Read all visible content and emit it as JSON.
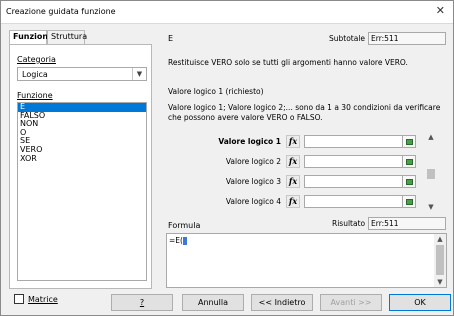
{
  "window": {
    "title": "Creazione guidata funzione",
    "close_glyph": "✕"
  },
  "tabs": [
    {
      "label": "Funzioni",
      "active": true
    },
    {
      "label": "Struttura",
      "active": false
    }
  ],
  "category": {
    "label": "Categoria",
    "value": "Logica"
  },
  "function_list": {
    "label": "Funzione",
    "items": [
      "E",
      "FALSO",
      "NON",
      "O",
      "SE",
      "VERO",
      "XOR"
    ],
    "selected": "E"
  },
  "function_info": {
    "name": "E",
    "subtotal_label": "Subtotale",
    "subtotal_value": "Err:511",
    "description": "Restituisce VERO solo se tutti gli argomenti hanno valore VERO.",
    "arg_title": "Valore logico 1 (richiesto)",
    "arg_description": "Valore logico 1; Valore logico 2;... sono da 1 a 30 condizioni da verificare che possono avere valore VERO o FALSO."
  },
  "arguments": [
    {
      "label": "Valore logico 1",
      "bold": true,
      "value": ""
    },
    {
      "label": "Valore logico 2",
      "bold": false,
      "value": ""
    },
    {
      "label": "Valore logico 3",
      "bold": false,
      "value": ""
    },
    {
      "label": "Valore logico 4",
      "bold": false,
      "value": ""
    }
  ],
  "fx_glyph": "fx",
  "formula": {
    "label": "Formula",
    "value": "=E(",
    "result_label": "Risultato",
    "result_value": "Err:511"
  },
  "bottom": {
    "matrix_label": "Matrice",
    "help_label": "?",
    "cancel_label": "Annulla",
    "back_label": "<< Indietro",
    "next_label": "Avanti >>",
    "ok_label": "OK"
  }
}
